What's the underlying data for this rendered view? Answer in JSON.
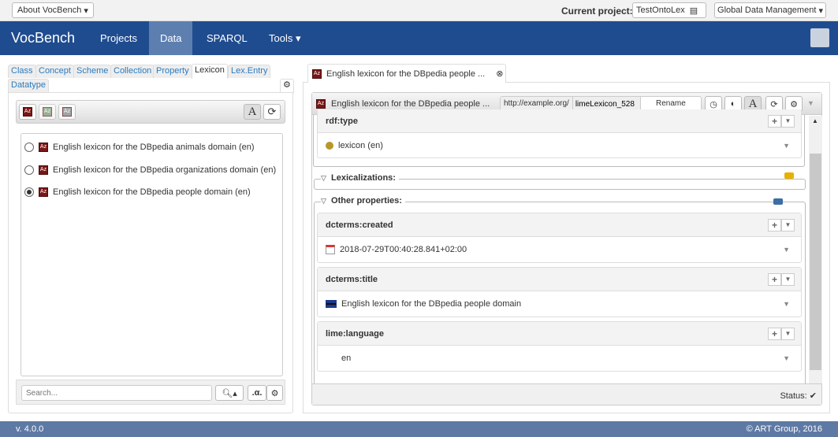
{
  "topbar": {
    "about": "About VocBench",
    "current_project_label": "Current project:",
    "current_project": "TestOntoLex",
    "global_data": "Global Data Management"
  },
  "nav": {
    "brand": "VocBench",
    "items": [
      "Projects",
      "Data",
      "SPARQL",
      "Tools"
    ],
    "active": "Data"
  },
  "left": {
    "tabs": [
      "Class",
      "Concept",
      "Scheme",
      "Collection",
      "Property",
      "Lexicon",
      "Lex.Entry",
      "Datatype"
    ],
    "selected_tab": "Lexicon",
    "lexicons": [
      {
        "label": "English lexicon for the DBpedia animals domain (en)",
        "selected": false
      },
      {
        "label": "English lexicon for the DBpedia organizations domain (en)",
        "selected": false
      },
      {
        "label": "English lexicon for the DBpedia people domain (en)",
        "selected": true
      }
    ],
    "search_placeholder": "Search...",
    "alpha_label": ".α."
  },
  "right": {
    "tab_title": "English lexicon for the DBpedia people ...",
    "header_title": "English lexicon for the DBpedia people ...",
    "namespace": "http://example.org/",
    "localname": "limeLexicon_528",
    "rename": "Rename",
    "rdf_type": {
      "label": "rdf:type",
      "value": "lexicon (en)"
    },
    "lexicalizations": "Lexicalizations:",
    "other_properties": "Other properties:",
    "properties": [
      {
        "label": "dcterms:created",
        "value": "2018-07-29T00:40:28.841+02:00",
        "icon": "calendar-icon"
      },
      {
        "label": "dcterms:title",
        "value": "English lexicon for the DBpedia people domain",
        "icon": "uk-flag-icon"
      },
      {
        "label": "lime:language",
        "value": "en",
        "icon": ""
      }
    ],
    "status_label": "Status:"
  },
  "footer": {
    "version": "v. 4.0.0",
    "copyright": "© ART Group, 2016"
  },
  "colors": {
    "nav": "#1f4c8f",
    "nav_active": "#5c7fb0",
    "footer": "#5e7aa4",
    "link": "#2a7bbf"
  }
}
